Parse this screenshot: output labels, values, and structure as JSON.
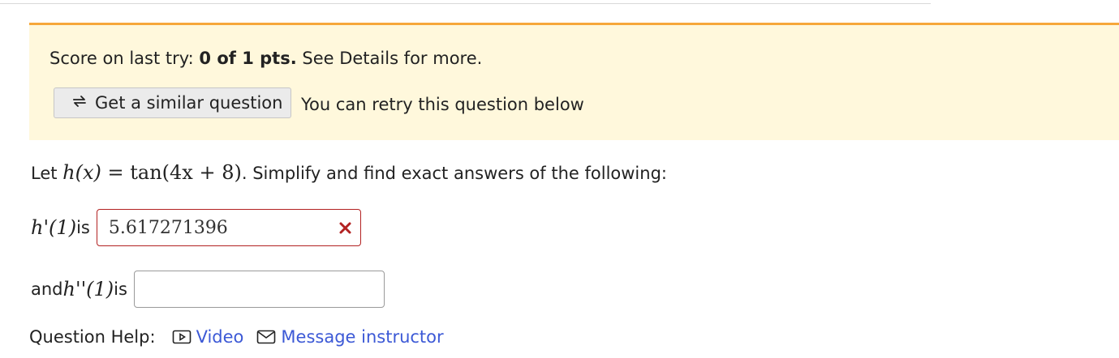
{
  "score": {
    "prefix": "Score on last try: ",
    "value": "0 of 1 pts.",
    "suffix": " See Details for more."
  },
  "similar_button": {
    "label": "Get a similar question",
    "icon": "retry-arrows-icon"
  },
  "retry_note": "You can retry this question below",
  "question": {
    "intro": "Let ",
    "function_lhs": "h(x)",
    "equals": " = ",
    "function_rhs": "tan(4x + 8)",
    "tail": ". Simplify and find exact answers of the following:"
  },
  "part1": {
    "expression": "h'(1)",
    "label_suffix": " is",
    "answer_value": "5.617271396",
    "status": "incorrect",
    "status_icon": "x-mark-icon"
  },
  "part2": {
    "label_prefix": "and ",
    "expression": "h''(1)",
    "label_suffix": " is",
    "answer_value": ""
  },
  "help": {
    "label": "Question Help:",
    "video_label": "Video",
    "message_label": "Message instructor"
  },
  "colors": {
    "banner_background": "#fff8dc",
    "banner_accent": "#f6a73b",
    "error": "#b22222",
    "link": "#3c59d6"
  }
}
